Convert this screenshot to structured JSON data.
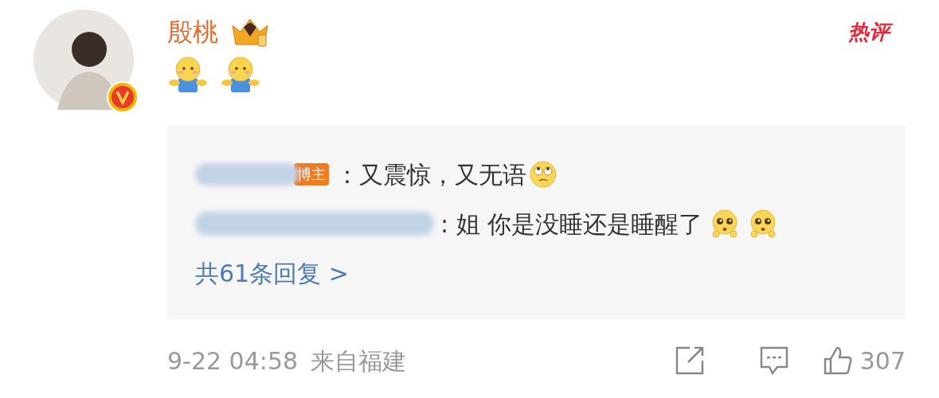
{
  "comment": {
    "author": "殷桃",
    "verified": true,
    "hot_label": "热评",
    "emojis": [
      {
        "kind": "hug"
      },
      {
        "kind": "hug"
      }
    ],
    "replies": [
      {
        "kind": "author",
        "badge": "博主",
        "text": "：又震惊，又无语",
        "emojis": [
          {
            "kind": "roll"
          }
        ]
      },
      {
        "kind": "user",
        "text": ": 姐 你是没睡还是睡醒了",
        "emojis": [
          {
            "kind": "plead"
          },
          {
            "kind": "plead"
          }
        ]
      }
    ],
    "more_replies": "共61条回复 >",
    "time": "9-22 04:58",
    "location": "来自福建",
    "likes": "307"
  }
}
